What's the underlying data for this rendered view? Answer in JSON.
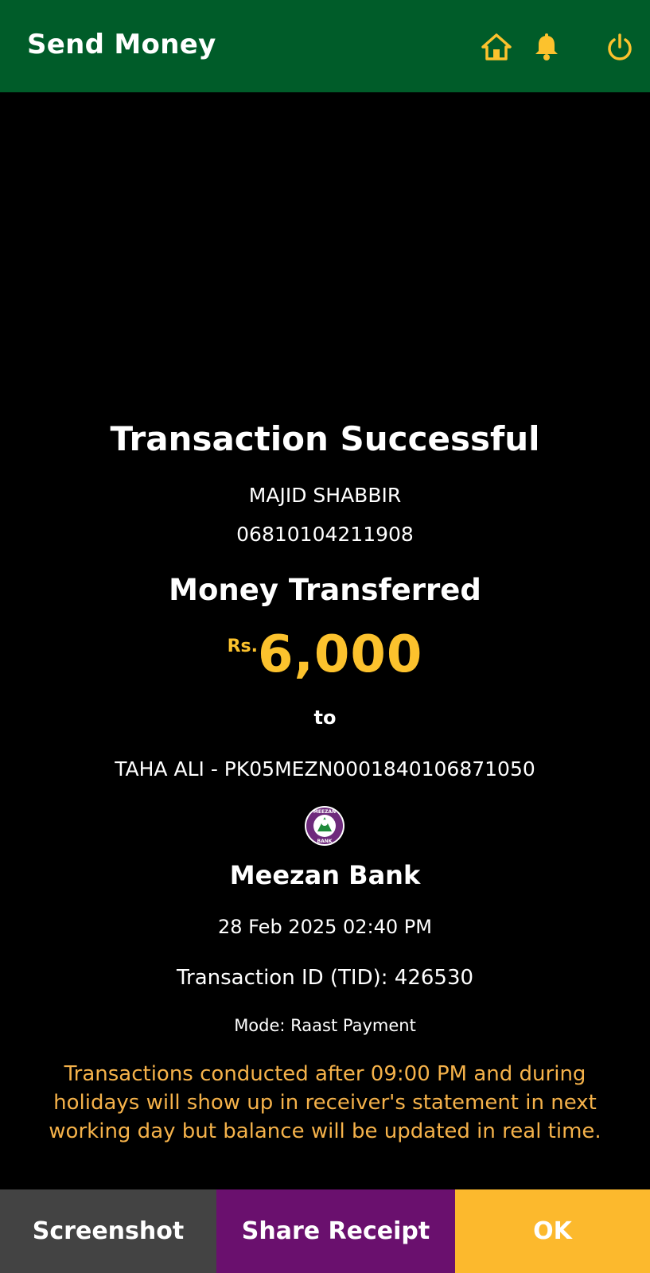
{
  "app_bar": {
    "title": "Send Money",
    "icons": [
      "home-icon",
      "bell-icon",
      "power-icon"
    ],
    "icon_color": "#fcc22d",
    "background": "#005c29"
  },
  "receipt": {
    "status": "Transaction Successful",
    "sender_name": "MAJID SHABBIR",
    "sender_account": "06810104211908",
    "transferred_label": "Money Transferred",
    "currency": "Rs.",
    "amount": "6,000",
    "to_label": "to",
    "receiver": "TAHA ALI - PK05MEZN0001840106871050",
    "bank_logo_text": "MEEZAN BANK",
    "bank_name": "Meezan Bank",
    "datetime": "28 Feb 2025 02:40 PM",
    "tid": "Transaction ID (TID): 426530",
    "mode": "Mode: Raast Payment",
    "notice": "Transactions conducted after 09:00 PM and during holidays will show up in receiver's statement in next working day but balance will be updated in real time."
  },
  "bottom_buttons": {
    "screenshot": "Screenshot",
    "share": "Share Receipt",
    "ok": "OK"
  }
}
